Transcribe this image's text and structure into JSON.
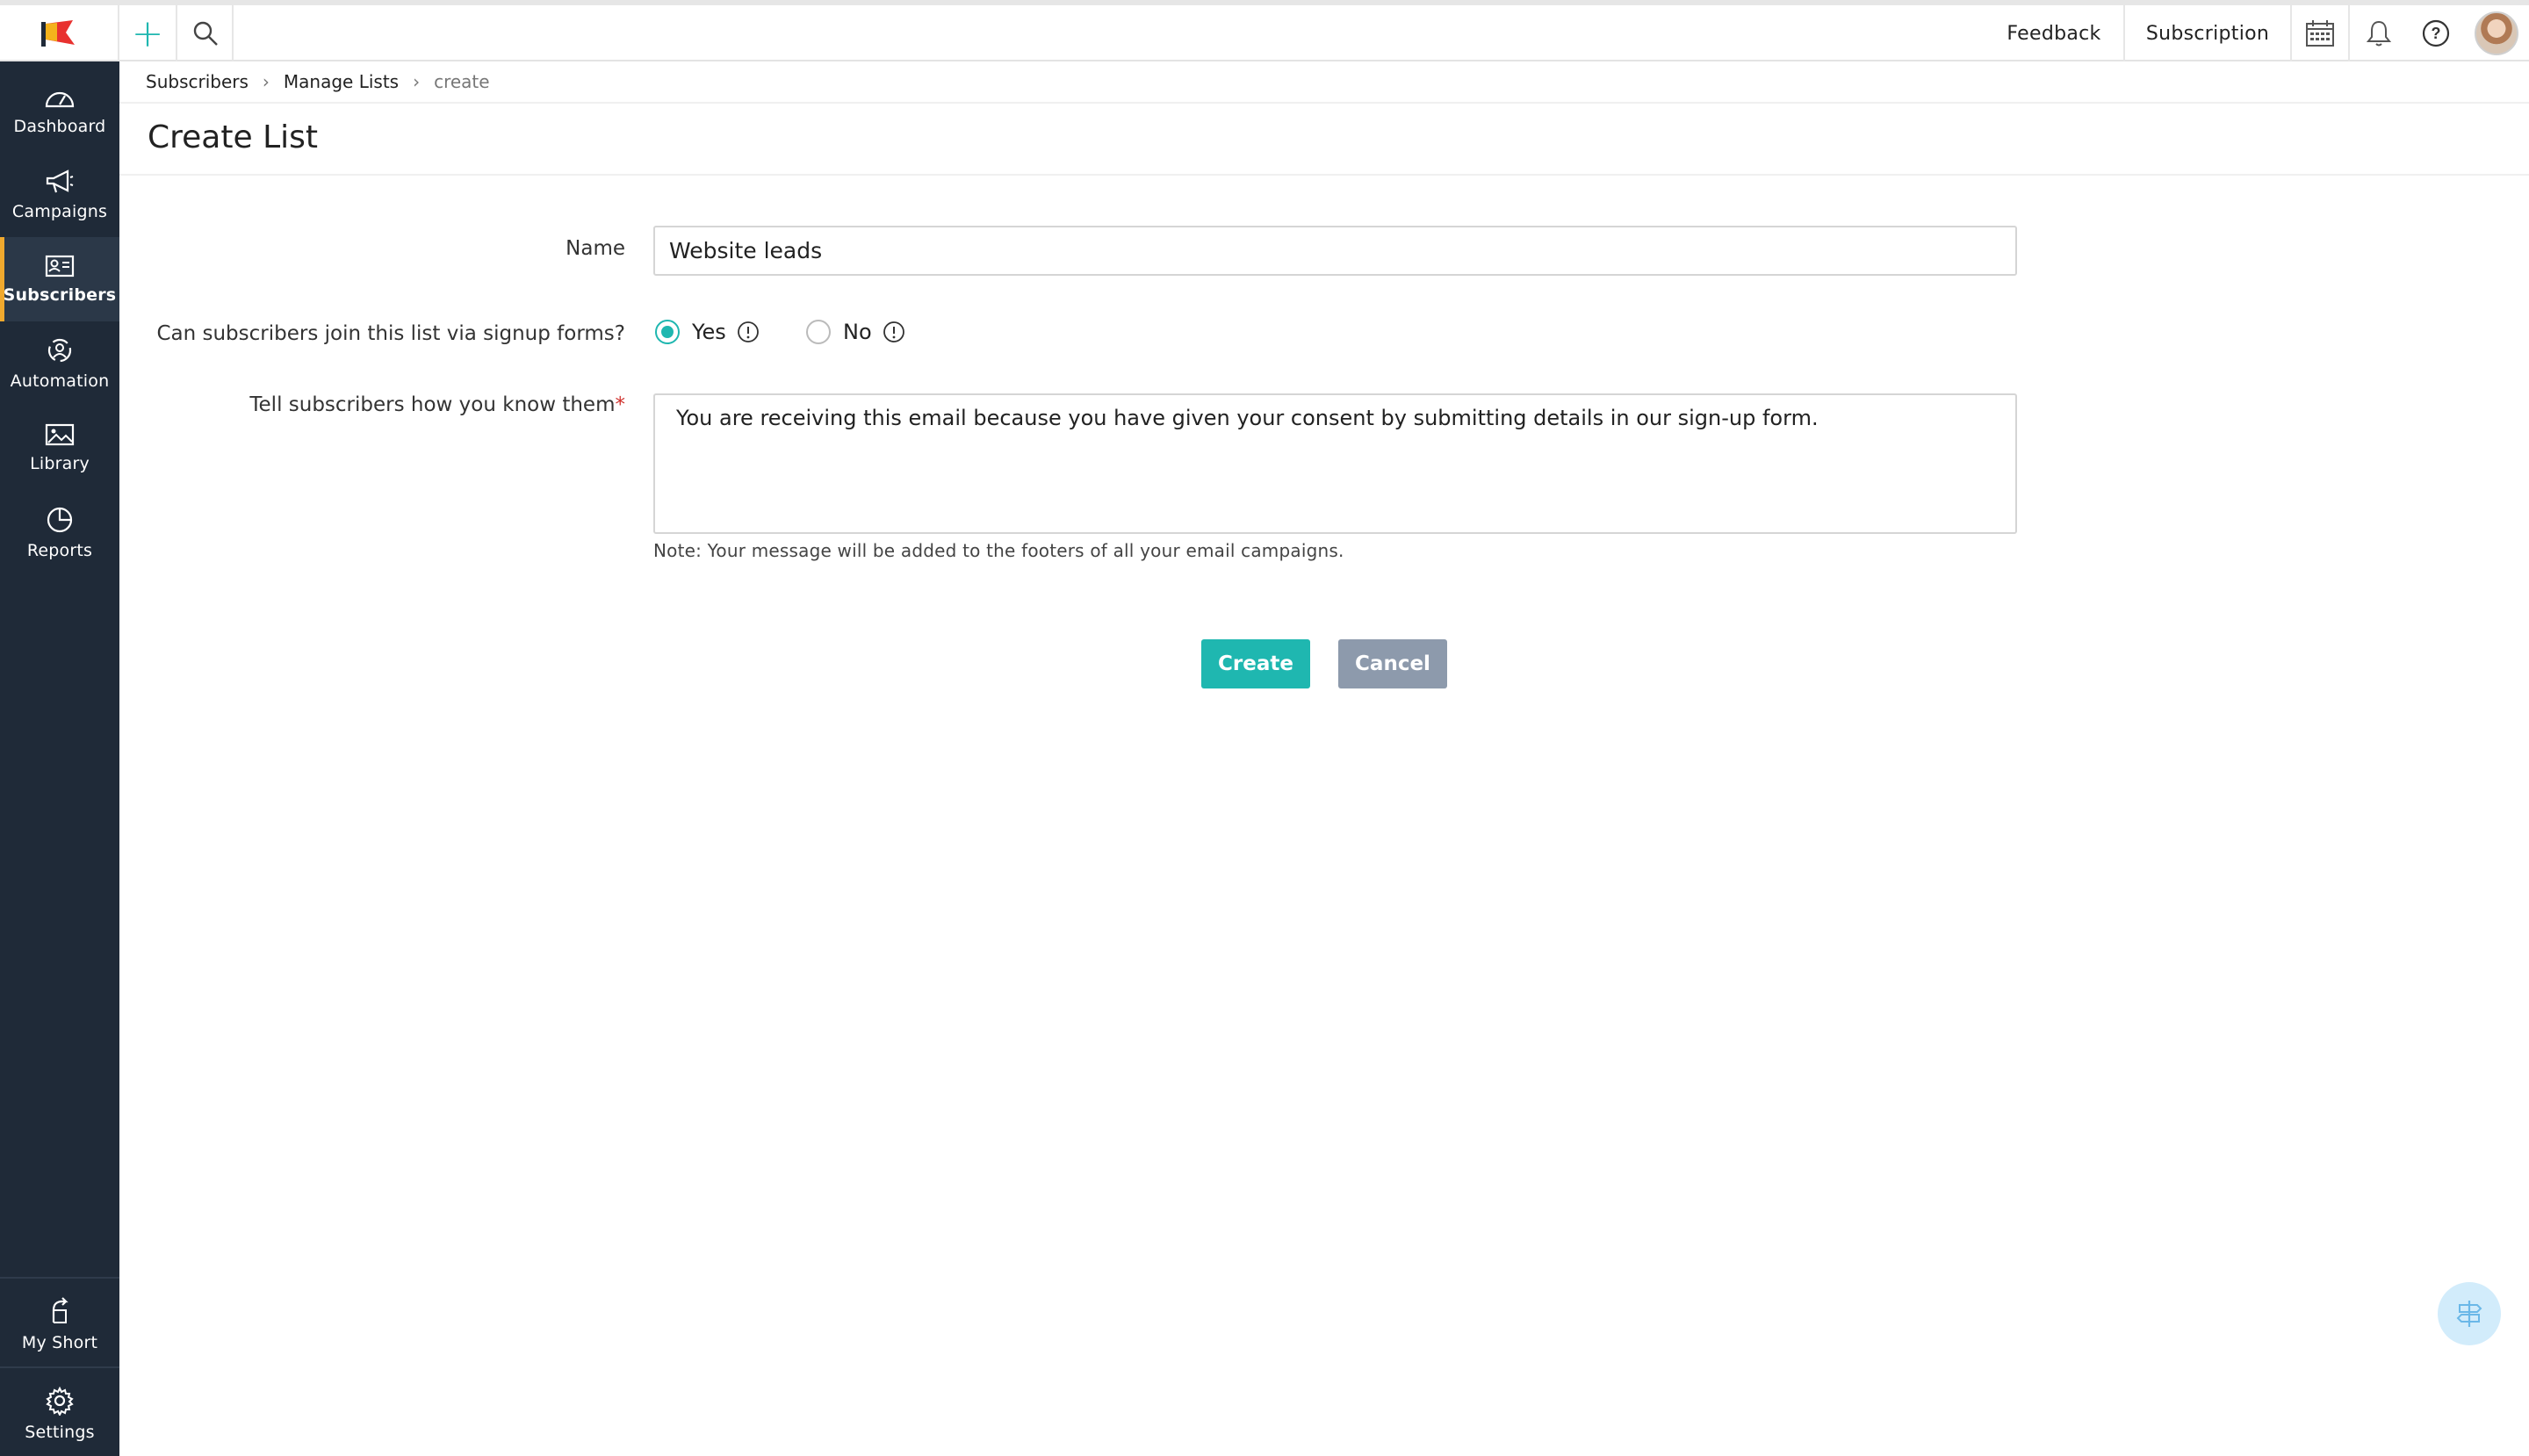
{
  "topbar": {
    "feedback_label": "Feedback",
    "subscription_label": "Subscription",
    "icons": [
      "logo-flag-icon",
      "plus-icon",
      "search-icon",
      "calendar-icon",
      "bell-icon",
      "help-icon",
      "avatar"
    ]
  },
  "sidebar": {
    "items": [
      {
        "label": "Dashboard",
        "icon": "dashboard-icon"
      },
      {
        "label": "Campaigns",
        "icon": "megaphone-icon"
      },
      {
        "label": "Subscribers",
        "icon": "contact-card-icon",
        "active": true
      },
      {
        "label": "Automation",
        "icon": "automation-icon"
      },
      {
        "label": "Library",
        "icon": "image-icon"
      },
      {
        "label": "Reports",
        "icon": "pie-chart-icon"
      }
    ],
    "bottom": [
      {
        "label": "My Short",
        "icon": "shortcut-icon"
      },
      {
        "label": "Settings",
        "icon": "gear-icon"
      }
    ]
  },
  "breadcrumb": {
    "items": [
      "Subscribers",
      "Manage Lists"
    ],
    "current": "create",
    "separator": "›"
  },
  "page": {
    "title": "Create List"
  },
  "form": {
    "name_label": "Name",
    "name_value": "Website leads",
    "join_label": "Can subscribers join this list via signup forms?",
    "yes_label": "Yes",
    "no_label": "No",
    "selected": "Yes",
    "tell_label": "Tell subscribers how you know them",
    "required_mark": "*",
    "consent_text": "You are receiving this email because you have given your consent by submitting details in our sign-up form.",
    "note": "Note: Your message will be added to the footers of all your email campaigns.",
    "create_label": "Create",
    "cancel_label": "Cancel"
  },
  "colors": {
    "accent": "#1fb7b0",
    "sidebar_bg": "#1f2a38",
    "active_marker": "#f0a92e",
    "cancel_bg": "#8d9aac",
    "required": "#d0312d"
  }
}
